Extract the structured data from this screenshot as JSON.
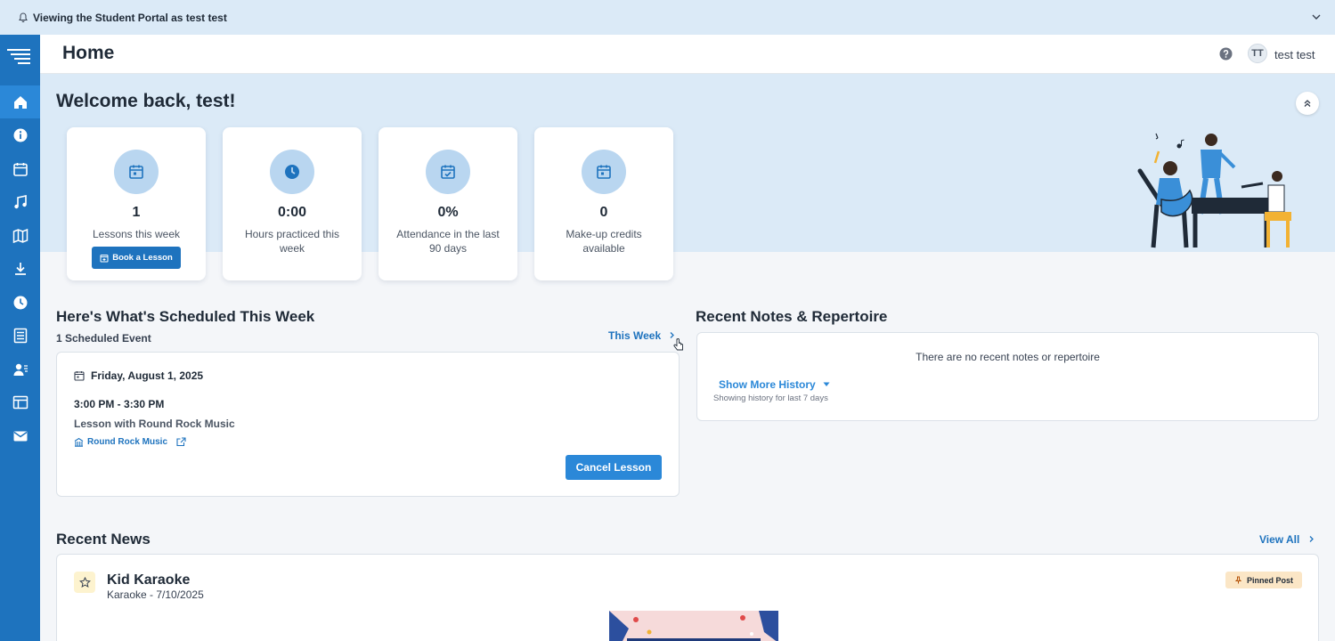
{
  "banner": {
    "text": "Viewing the Student Portal as test test"
  },
  "header": {
    "title": "Home",
    "avatar_initials": "TT",
    "user_name": "test test"
  },
  "hero": {
    "welcome": "Welcome back, test!"
  },
  "stats": [
    {
      "value": "1",
      "label": "Lessons this week",
      "icon": "calendar-icon"
    },
    {
      "value": "0:00",
      "label": "Hours practiced this week",
      "icon": "clock-icon"
    },
    {
      "value": "0%",
      "label": "Attendance in the last 90 days",
      "icon": "calendar-check-icon"
    },
    {
      "value": "0",
      "label": "Make-up credits available",
      "icon": "calendar-icon"
    }
  ],
  "book_button": "Book a Lesson",
  "schedule": {
    "title": "Here's What's Scheduled This Week",
    "count": "1 Scheduled Event",
    "week_link": "This Week",
    "event": {
      "date": "Friday, August 1, 2025",
      "time": "3:00 PM - 3:30 PM",
      "lesson": "Lesson with Round Rock Music",
      "location": "Round Rock Music",
      "cancel_label": "Cancel Lesson"
    }
  },
  "notes": {
    "title": "Recent Notes & Repertoire",
    "empty": "There are no recent notes or repertoire",
    "show_more": "Show More History",
    "history_note": "Showing history for last 7 days"
  },
  "news": {
    "title": "Recent News",
    "view_all": "View All",
    "post": {
      "title": "Kid Karaoke",
      "meta": "Karaoke - 7/10/2025",
      "badge": "Pinned Post"
    }
  },
  "sidebar": {
    "items": [
      "home-icon",
      "info-icon",
      "calendar-icon",
      "music-note-icon",
      "map-icon",
      "download-icon",
      "clock-icon",
      "list-icon",
      "contacts-icon",
      "table-icon",
      "mail-icon"
    ]
  },
  "colors": {
    "primary": "#1e73be",
    "hero_bg": "#dbeaf7",
    "icon_circle": "#b9d6f0",
    "badge_bg": "#fbe6c6"
  }
}
